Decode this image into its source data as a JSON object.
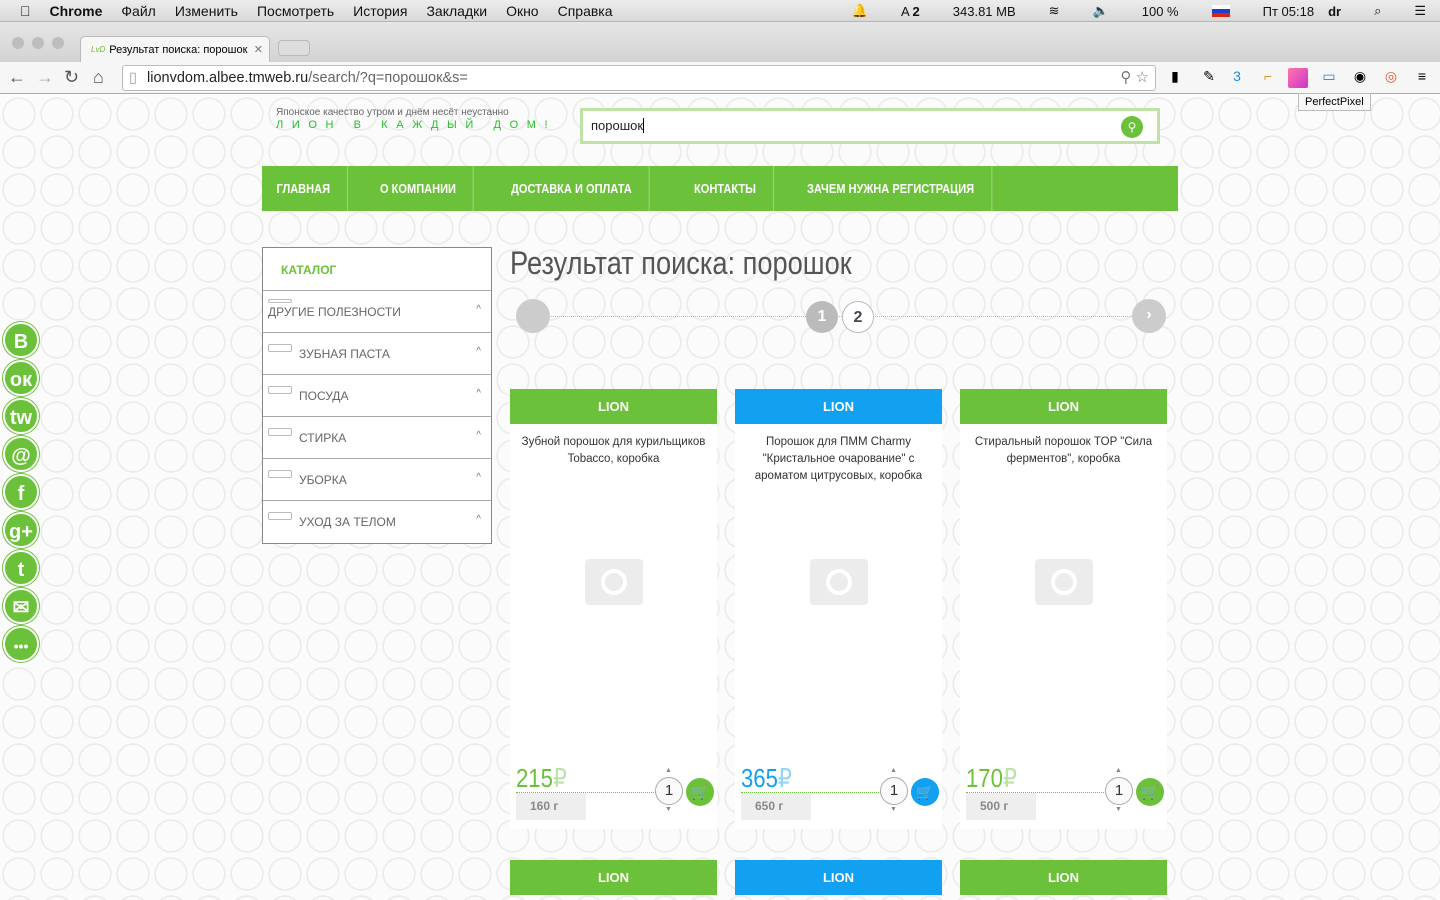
{
  "menubar": {
    "apple": "",
    "app": "Chrome",
    "items": [
      "Файл",
      "Изменить",
      "Посмотреть",
      "История",
      "Закладки",
      "Окно",
      "Справка"
    ],
    "status": {
      "adobe_count": "2",
      "memory": "343.81 MB",
      "battery": "100 %",
      "time": "Пт 05:18",
      "user": "dr"
    }
  },
  "browser": {
    "tab_title": "Результат поиска: порошок",
    "tab_favicon": "LvD",
    "url_host": "lionvdom.albee.tmweb.ru",
    "url_path": "/search/?q=порошок&s=",
    "tooltip": "PerfectPixel"
  },
  "site": {
    "slogan": "Японское качество утром и днём несёт неустанно",
    "slogan2": "ЛИОН В КАЖДЫЙ ДОМ!",
    "search_value": "порошок",
    "nav": [
      "ГЛАВНАЯ",
      "О КОМПАНИИ",
      "ДОСТАВКА И ОПЛАТА",
      "КОНТАКТЫ",
      "ЗАЧЕМ НУЖНА РЕГИСТРАЦИЯ"
    ],
    "catalog": {
      "title": "КАТАЛОГ",
      "items": [
        "ДРУГИЕ ПОЛЕЗНОСТИ",
        "ЗУБНАЯ ПАСТА",
        "ПОСУДА",
        "СТИРКА",
        "УБОРКА",
        "УХОД ЗА ТЕЛОМ"
      ]
    },
    "page_title": "Результат поиска: порошок",
    "pagination": {
      "pages": [
        "1",
        "2"
      ],
      "current": "1"
    },
    "products": [
      {
        "brand": "LION",
        "name": "Зубной порошок для курильщиков Tobacco, коробка",
        "price": "215",
        "currency": "₽",
        "weight": "160 г",
        "qty": "1",
        "color": "#6cc13a"
      },
      {
        "brand": "LION",
        "name": "Порошок для ПММ Charmy \"Кристальное очарование\" с ароматом цитрусовых, коробка",
        "price": "365",
        "currency": "₽",
        "weight": "650 г",
        "qty": "1",
        "color": "#12a0f0"
      },
      {
        "brand": "LION",
        "name": "Стиральный порошок TOP \"Сила ферментов\", коробка",
        "price": "170",
        "currency": "₽",
        "weight": "500 г",
        "qty": "1",
        "color": "#6cc13a"
      }
    ],
    "next_row": [
      {
        "brand": "LION"
      },
      {
        "brand": "LION"
      },
      {
        "brand": "LION"
      }
    ],
    "social": [
      "В",
      "ок",
      "tw",
      "@",
      "f",
      "g+",
      "t",
      "✉",
      "•••"
    ]
  }
}
